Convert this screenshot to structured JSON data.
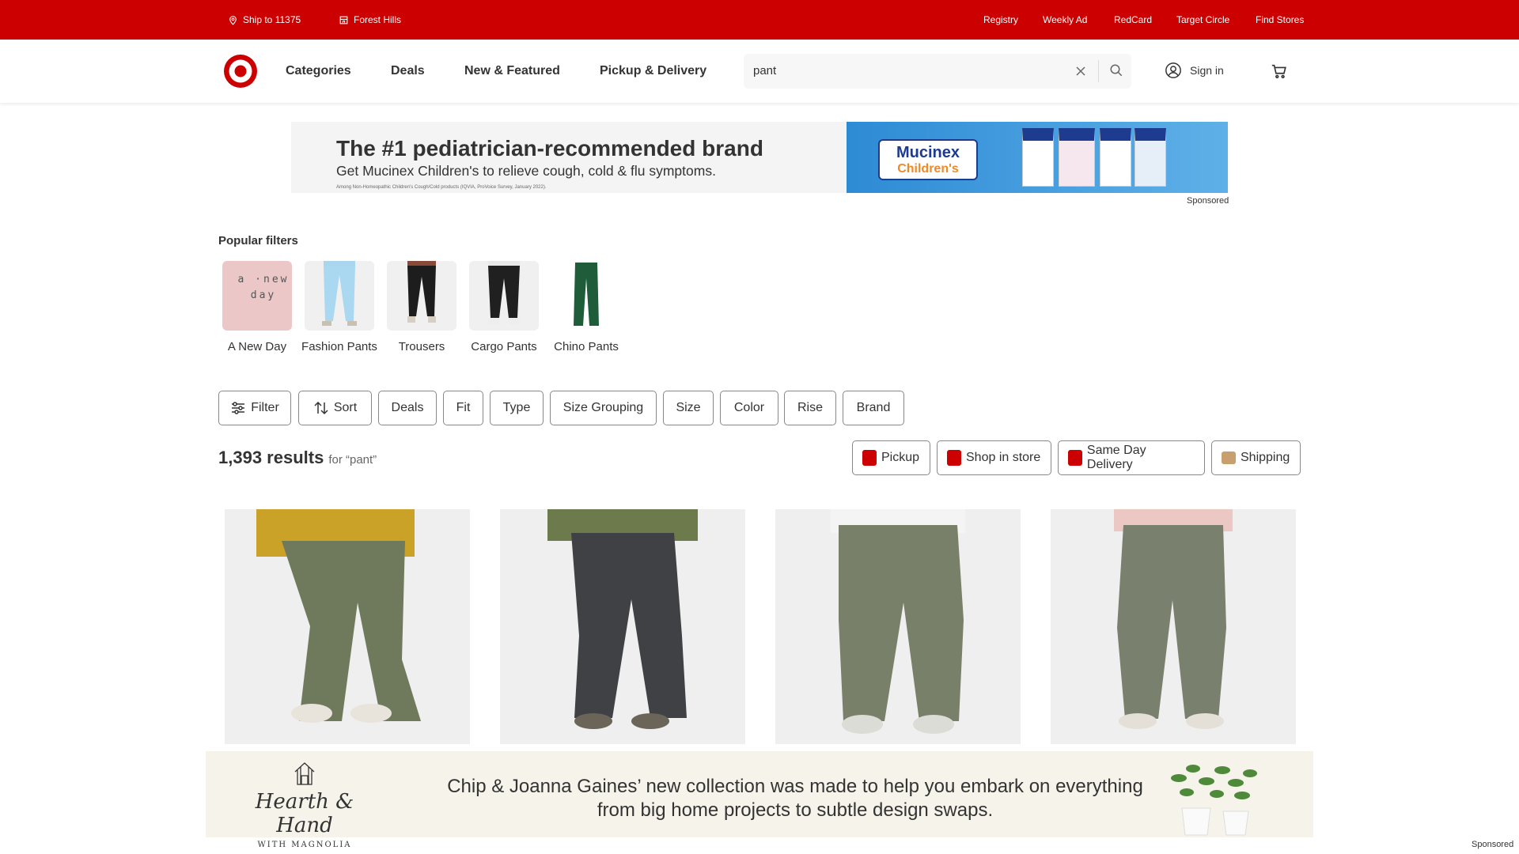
{
  "topbar": {
    "ship_to": "Ship to 11375",
    "store": "Forest Hills",
    "links": [
      "Registry",
      "Weekly Ad",
      "RedCard",
      "Target Circle",
      "Find Stores"
    ]
  },
  "header": {
    "nav": [
      "Categories",
      "Deals",
      "New & Featured",
      "Pickup & Delivery"
    ],
    "search_value": "pant",
    "sign_in": "Sign in"
  },
  "banner": {
    "headline": "The #1 pediatrician-recommended brand",
    "subline": "Get Mucinex Children's to relieve cough, cold & flu symptoms.",
    "footnote": "Among Non-Homeopathic Children's Cough/Cold products (IQVIA, ProVoice Survey, January 2022).",
    "brand_top": "Mucinex",
    "brand_bottom": "Children's",
    "sponsored": "Sponsored"
  },
  "popular_filters": {
    "title": "Popular filters",
    "items": [
      {
        "label": "A New Day",
        "thumb_text": "a ·new day"
      },
      {
        "label": "Fashion Pants"
      },
      {
        "label": "Trousers"
      },
      {
        "label": "Cargo Pants"
      },
      {
        "label": "Chino Pants"
      }
    ]
  },
  "filter_chips": [
    "Filter",
    "Sort",
    "Deals",
    "Fit",
    "Type",
    "Size Grouping",
    "Size",
    "Color",
    "Rise",
    "Brand"
  ],
  "results": {
    "count": "1,393 results",
    "query": "for “pant”"
  },
  "fulfillment": [
    "Pickup",
    "Shop in store",
    "Same Day Delivery",
    "Shipping"
  ],
  "products": [
    {
      "color": "#6f7a5c",
      "shirt": "#c9a227",
      "shoe": "#e8e4dc"
    },
    {
      "color": "#3f4144",
      "shirt": "#6d7a4c",
      "shoe": "#6a6558"
    },
    {
      "color": "#78806a",
      "shirt": "#f4f4f4",
      "shoe": "#dcdcd6"
    },
    {
      "color": "#7a806e",
      "shirt": "#ecc8c5",
      "shoe": "#e4e0d8"
    }
  ],
  "bottom_ad": {
    "brand": "Hearth & Hand",
    "brand_sub": "WITH MAGNOLIA",
    "line1": "Chip & Joanna Gaines’ new collection was made to help you embark on everything",
    "line2": "from big home projects to subtle design swaps.",
    "sponsored": "Sponsored"
  },
  "colors": {
    "brand_red": "#cc0000"
  }
}
